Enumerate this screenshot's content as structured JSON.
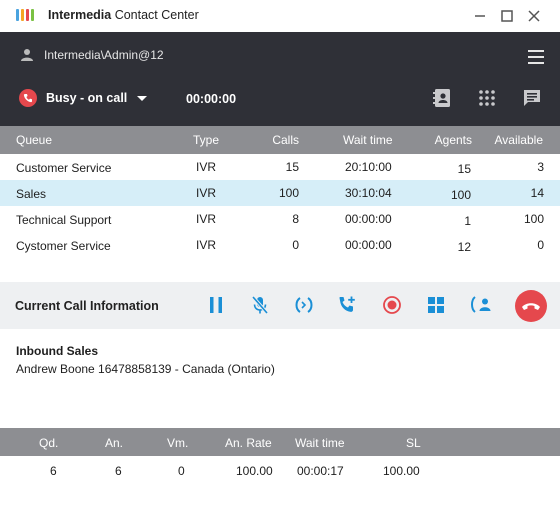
{
  "window": {
    "brand": "Intermedia",
    "title": "Contact Center",
    "logo_colors": [
      "#4aa3df",
      "#f5a623",
      "#e5484d",
      "#7ac143"
    ]
  },
  "header": {
    "user": "Intermedia\\Admin@12",
    "status": "Busy - on call",
    "timer": "00:00:00",
    "status_color": "#e5484d"
  },
  "queues": {
    "columns": [
      "Queue",
      "Type",
      "Calls",
      "Wait time",
      "Agents",
      "Available"
    ],
    "rows": [
      [
        "Customer Service",
        "IVR",
        "15",
        "20:10:00",
        "15",
        "3"
      ],
      [
        "Sales",
        "IVR",
        "100",
        "30:10:04",
        "100",
        "14"
      ],
      [
        "Technical Support",
        "IVR",
        "8",
        "00:00:00",
        "1",
        "100"
      ],
      [
        "Cystomer Service",
        "IVR",
        "0",
        "00:00:00",
        "12",
        "0"
      ]
    ]
  },
  "call": {
    "section_title": "Current Call Information",
    "queue_name": "Inbound Sales",
    "caller": "Andrew Boone 16478858139 - Canada (Ontario)",
    "accent": "#1a8fd6"
  },
  "stats": {
    "columns": [
      "Qd.",
      "An.",
      "Vm.",
      "An. Rate",
      "Wait time",
      "SL"
    ],
    "values": [
      "6",
      "6",
      "0",
      "100.00",
      "00:00:17",
      "100.00"
    ]
  }
}
